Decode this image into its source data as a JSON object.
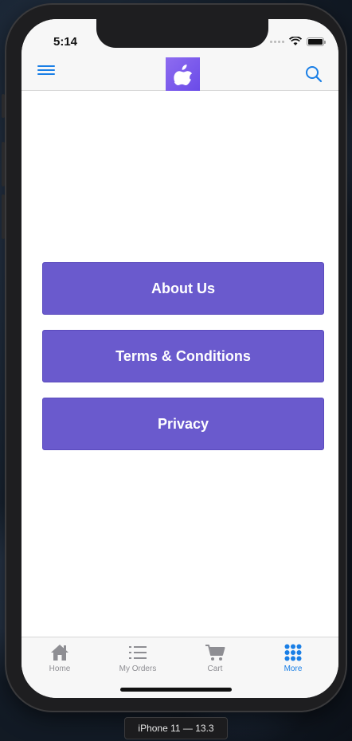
{
  "status_bar": {
    "time": "5:14"
  },
  "navbar": {
    "menu_icon": "hamburger-menu-icon",
    "logo_icon": "apple-logo-icon",
    "search_icon": "search-icon",
    "accent_color": "#1a7fe6"
  },
  "main": {
    "buttons": [
      {
        "label": "About Us"
      },
      {
        "label": "Terms & Conditions"
      },
      {
        "label": "Privacy"
      }
    ],
    "button_color": "#6a5acd"
  },
  "tabbar": {
    "tabs": [
      {
        "label": "Home",
        "icon": "home-icon",
        "active": false
      },
      {
        "label": "My Orders",
        "icon": "list-icon",
        "active": false
      },
      {
        "label": "Cart",
        "icon": "cart-icon",
        "active": false
      },
      {
        "label": "More",
        "icon": "grid-dots-icon",
        "active": true
      }
    ]
  },
  "simulator": {
    "device_label": "iPhone 11 — 13.3"
  }
}
